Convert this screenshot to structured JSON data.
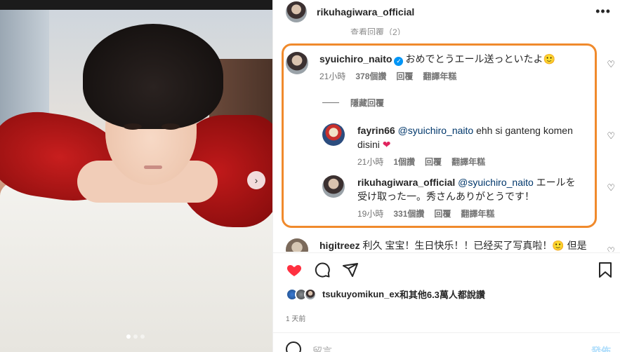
{
  "header": {
    "username": "rikuhagiwara_official",
    "more_icon": "more-horizontal-icon"
  },
  "thread_top_cut": "查看回覆（2）",
  "main_comment": {
    "username": "syuichiro_naito",
    "verified": true,
    "text": "おめでとうエール送っといたよ",
    "emoji": "🙂",
    "time": "21小時",
    "likes": "378個讚",
    "reply": "回覆",
    "translate": "翻譯年糕"
  },
  "hide_replies": "隱藏回覆",
  "replies": [
    {
      "username": "fayrin66",
      "mention": "@syuichiro_naito",
      "text": " ehh si ganteng komen disini",
      "emoji": "❤",
      "time": "21小時",
      "likes": "1個讚",
      "reply": "回覆",
      "translate": "翻譯年糕"
    },
    {
      "username": "rikuhagiwara_official",
      "mention": "@syuichiro_naito",
      "text": " エールを受け取った一。秀さんありがとうです！",
      "time": "19小時",
      "likes": "331個讚",
      "reply": "回覆",
      "translate": "翻譯年糕"
    }
  ],
  "next_comment_cut": {
    "username": "higitreez",
    "text": "利久 宝宝！生日快乐！！已经买了写真啦！🙂 但是"
  },
  "likes_summary": {
    "users": "tsukuyomikun_ex",
    "joiner": "和",
    "others": "其他6.3萬人都說讚"
  },
  "time_ago": "1 天前",
  "add_comment": {
    "placeholder": "留言……",
    "post": "發佈"
  },
  "accent_color": "#f08a2c"
}
